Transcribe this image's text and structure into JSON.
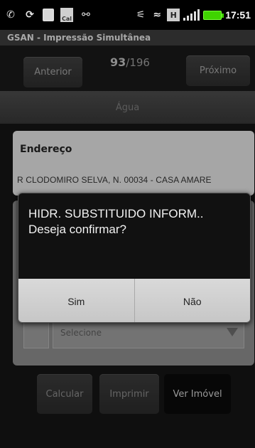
{
  "status_bar": {
    "icons": [
      "phone-icon",
      "sync-icon",
      "sd-card-icon",
      "calendar-icon",
      "usb-icon",
      "bluetooth-icon",
      "vibrate-icon",
      "h-data-icon",
      "signal-icon",
      "battery-icon"
    ],
    "calendar_label": "Cal",
    "h_label": "H",
    "time": "17:51",
    "battery_color": "#3fd400"
  },
  "app": {
    "title": "GSAN - Impressão Simultânea"
  },
  "nav": {
    "prev_label": "Anterior",
    "next_label": "Próximo",
    "current": "93",
    "total": "/196"
  },
  "section": {
    "title": "Água"
  },
  "address": {
    "label": "Endereço",
    "value": "R CLODOMIRO SELVA, N. 00034 - CASA AMARE"
  },
  "form": {
    "select_value": "Selecione"
  },
  "actions": {
    "calc_label": "Calcular",
    "print_label": "Imprimir",
    "view_label": "Ver Imóvel"
  },
  "dialog": {
    "line1": "HIDR. SUBSTITUIDO INFORM..",
    "line2": "Deseja confirmar?",
    "yes_label": "Sim",
    "no_label": "Não"
  }
}
